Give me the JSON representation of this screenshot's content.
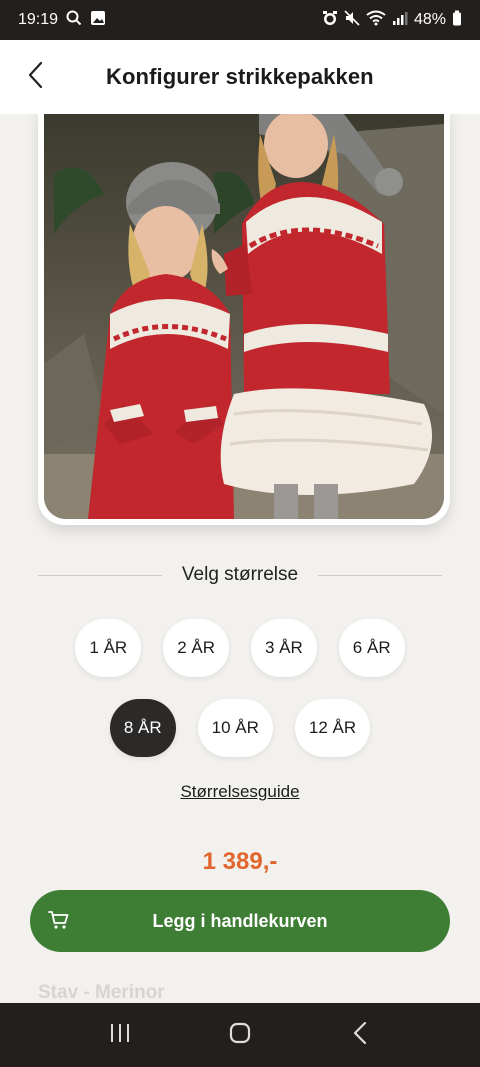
{
  "status_bar": {
    "time": "19:19",
    "battery": "48%",
    "icons": [
      "search-icon",
      "gallery-icon",
      "alarm-icon",
      "mute-icon",
      "wifi-icon",
      "signal-icon",
      "battery-icon"
    ]
  },
  "header": {
    "title": "Konfigurer strikkepakken",
    "back_icon": "chevron-left-icon"
  },
  "product_image": {
    "description_icon": "product-photo"
  },
  "size_section": {
    "title": "Velg størrelse",
    "row1": [
      "1 ÅR",
      "2 ÅR",
      "3 ÅR",
      "6 ÅR"
    ],
    "row2": [
      "8 ÅR",
      "10 ÅR",
      "12 ÅR"
    ],
    "selected": "8 ÅR",
    "guide_link": "Størrelsesguide"
  },
  "price": "1 389,-",
  "cart_button": {
    "label": "Legg i handlekurven",
    "icon": "cart-icon"
  },
  "next_section_title": "Stav - Merinor",
  "colors": {
    "accent_green": "#3e7d34",
    "price_orange": "#e1662e",
    "selected_dark": "#2c2a28"
  },
  "nav_bar": {
    "icons": [
      "recent-apps-icon",
      "home-icon",
      "back-icon"
    ]
  }
}
